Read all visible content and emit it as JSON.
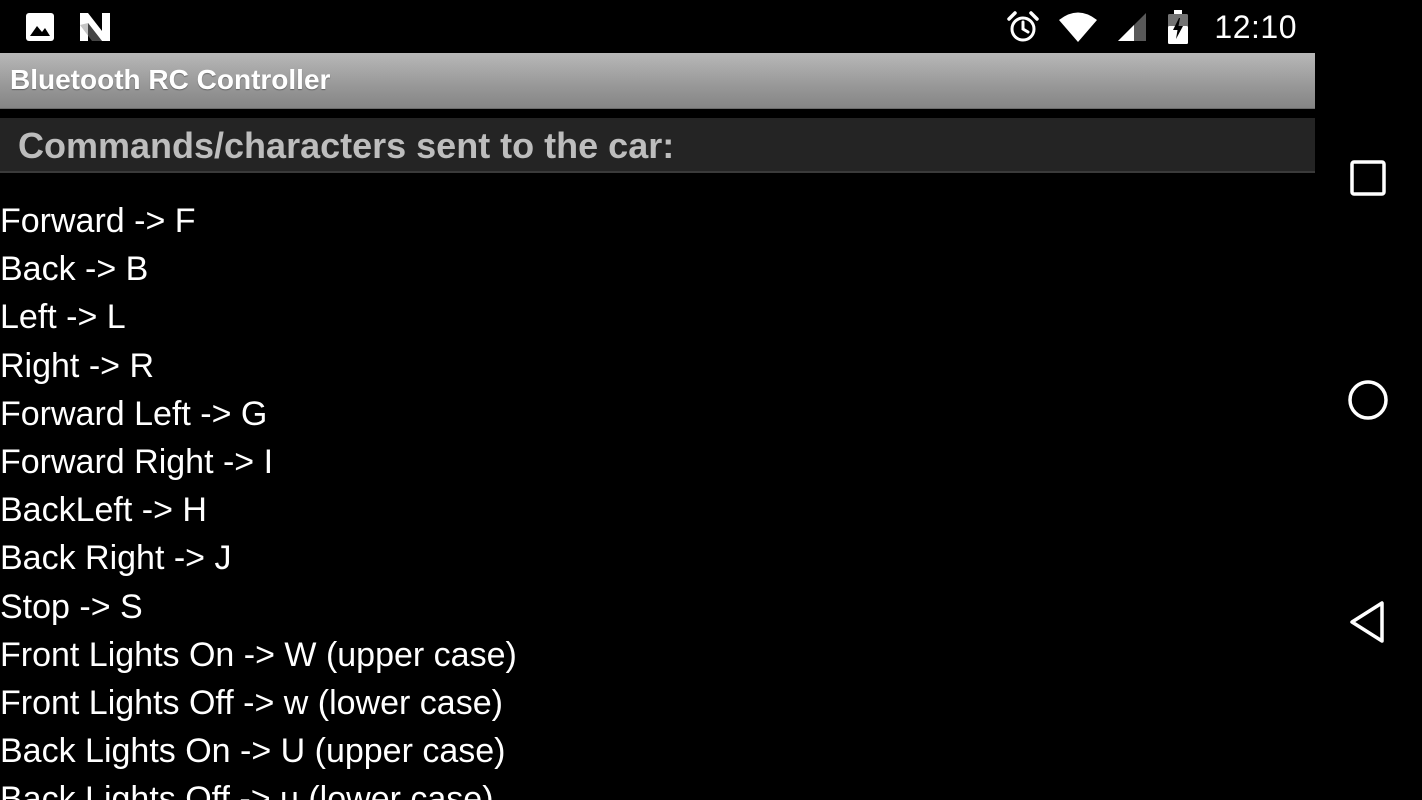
{
  "status_bar": {
    "left_icons": [
      "image-icon",
      "n-notification-icon"
    ],
    "right_icons": [
      "alarm-icon",
      "wifi-icon",
      "cell-signal-icon",
      "battery-charging-icon"
    ],
    "time": "12:10"
  },
  "action_bar": {
    "title": "Bluetooth RC Controller"
  },
  "section": {
    "title": "Commands/characters sent to the car:"
  },
  "commands": [
    "Forward -> F",
    "Back -> B",
    "Left -> L",
    "Right -> R",
    "Forward Left -> G",
    "Forward Right -> I",
    "BackLeft -> H",
    "Back Right -> J",
    "Stop -> S",
    "Front Lights On -> W (upper case)",
    "Front Lights Off -> w (lower case)",
    "Back Lights On -> U (upper case)",
    "Back Lights Off -> u (lower case)"
  ],
  "nav_bar": {
    "buttons": [
      "recents-button",
      "home-button",
      "back-button"
    ]
  },
  "colors": {
    "background": "#000000",
    "action_bar_gradient_top": "#b8b8b8",
    "action_bar_gradient_bottom": "#858585",
    "section_header_bg": "#242424",
    "section_title": "#bdbdbd",
    "text": "#ffffff"
  }
}
